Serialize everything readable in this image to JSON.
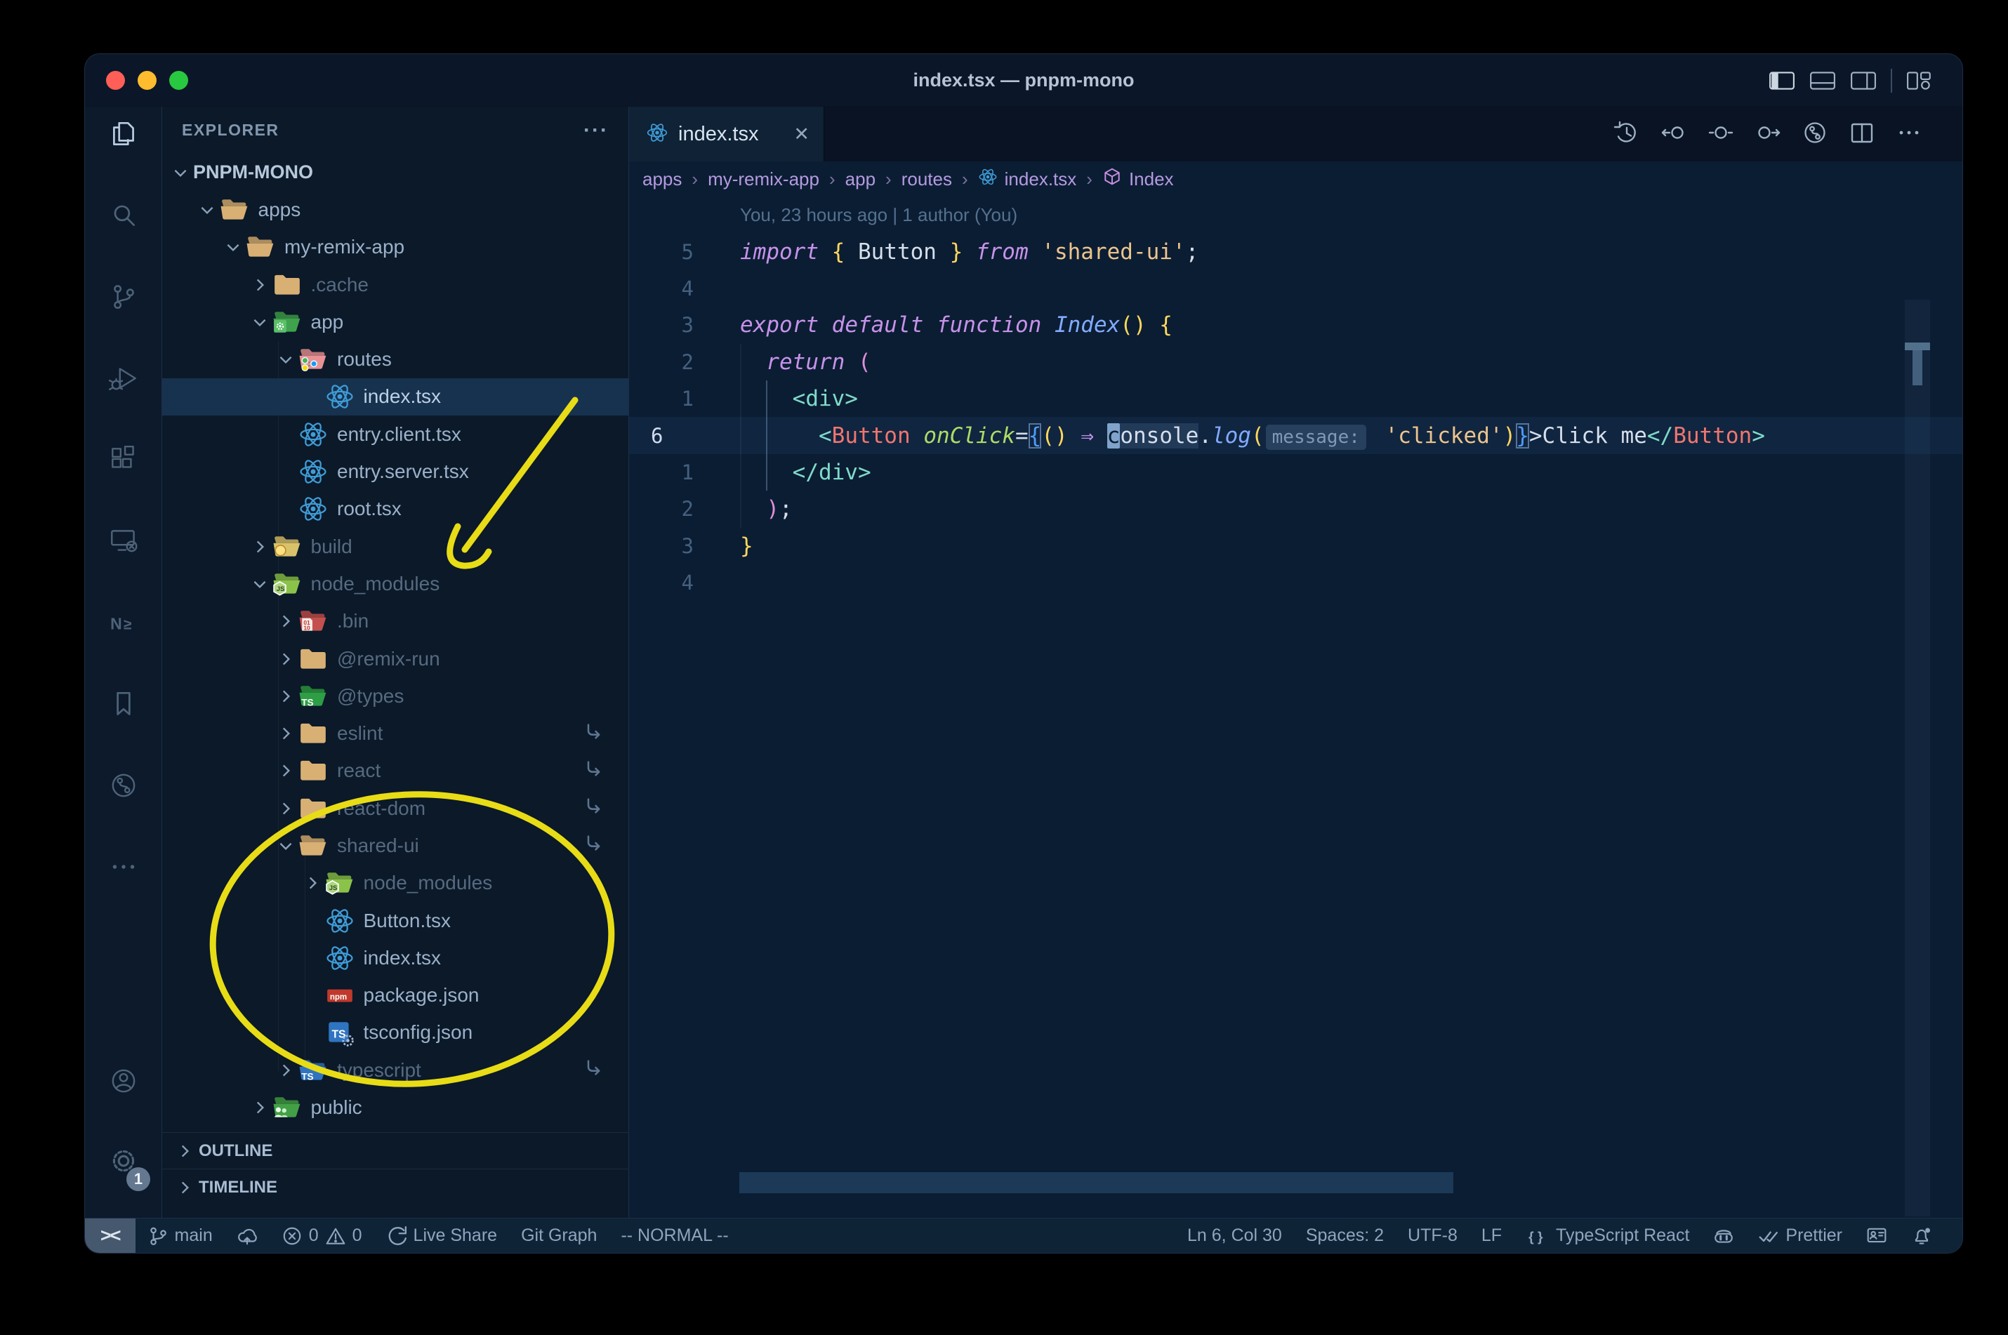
{
  "window": {
    "title": "index.tsx — pnpm-mono"
  },
  "titlebar": {
    "traffic_lights": [
      "close",
      "minimize",
      "zoom"
    ],
    "layout_buttons": [
      "layout-sidebar-left",
      "layout-panel",
      "layout-sidebar-right",
      "layout-customize"
    ]
  },
  "activity_bar": {
    "top": [
      {
        "name": "explorer",
        "active": true
      },
      {
        "name": "search"
      },
      {
        "name": "source-control"
      },
      {
        "name": "run-and-debug"
      },
      {
        "name": "extensions"
      },
      {
        "name": "remote-explorer"
      },
      {
        "name": "nx-console"
      },
      {
        "name": "bookmarks"
      },
      {
        "name": "gitlens"
      },
      {
        "name": "more"
      }
    ],
    "bottom": [
      {
        "name": "accounts"
      },
      {
        "name": "manage",
        "badge": "1"
      }
    ]
  },
  "sidebar": {
    "title": "EXPLORER",
    "actions_label": "···",
    "tree": [
      {
        "label": "PNPM-MONO",
        "depth": 0,
        "chevron": "open",
        "section": true
      },
      {
        "label": "apps",
        "depth": 1,
        "icon": "folder-open",
        "chevron": "open"
      },
      {
        "label": "my-remix-app",
        "depth": 2,
        "icon": "folder-open",
        "chevron": "open"
      },
      {
        "label": ".cache",
        "depth": 3,
        "icon": "folder",
        "chevron": "closed",
        "dim": true
      },
      {
        "label": "app",
        "depth": 3,
        "icon": "folder-app",
        "chevron": "open"
      },
      {
        "label": "routes",
        "depth": 4,
        "icon": "folder-routes",
        "chevron": "open"
      },
      {
        "label": "index.tsx",
        "depth": 5,
        "icon": "react",
        "selected": true
      },
      {
        "label": "entry.client.tsx",
        "depth": 4,
        "icon": "react"
      },
      {
        "label": "entry.server.tsx",
        "depth": 4,
        "icon": "react"
      },
      {
        "label": "root.tsx",
        "depth": 4,
        "icon": "react"
      },
      {
        "label": "build",
        "depth": 3,
        "icon": "folder-build",
        "chevron": "closed",
        "dim": true
      },
      {
        "label": "node_modules",
        "depth": 3,
        "icon": "folder-node",
        "chevron": "open",
        "dim": true
      },
      {
        "label": ".bin",
        "depth": 4,
        "icon": "folder-bin",
        "chevron": "closed",
        "dim": true
      },
      {
        "label": "@remix-run",
        "depth": 4,
        "icon": "folder",
        "chevron": "closed",
        "dim": true
      },
      {
        "label": "@types",
        "depth": 4,
        "icon": "folder-types",
        "chevron": "closed",
        "dim": true
      },
      {
        "label": "eslint",
        "depth": 4,
        "icon": "folder",
        "chevron": "closed",
        "dim": true,
        "symlink": true
      },
      {
        "label": "react",
        "depth": 4,
        "icon": "folder",
        "chevron": "closed",
        "dim": true,
        "symlink": true
      },
      {
        "label": "react-dom",
        "depth": 4,
        "icon": "folder",
        "chevron": "closed",
        "dim": true,
        "symlink": true
      },
      {
        "label": "shared-ui",
        "depth": 4,
        "icon": "folder-open",
        "chevron": "open",
        "dim": true,
        "symlink": true
      },
      {
        "label": "node_modules",
        "depth": 5,
        "icon": "folder-node",
        "chevron": "closed",
        "dim": true
      },
      {
        "label": "Button.tsx",
        "depth": 5,
        "icon": "react"
      },
      {
        "label": "index.tsx",
        "depth": 5,
        "icon": "react"
      },
      {
        "label": "package.json",
        "depth": 5,
        "icon": "npm"
      },
      {
        "label": "tsconfig.json",
        "depth": 5,
        "icon": "tsconfig"
      },
      {
        "label": "typescript",
        "depth": 4,
        "icon": "folder-ts",
        "chevron": "closed",
        "dim": true,
        "symlink": true
      },
      {
        "label": "public",
        "depth": 3,
        "icon": "folder-public",
        "chevron": "closed"
      }
    ],
    "sections": [
      {
        "label": "OUTLINE"
      },
      {
        "label": "TIMELINE"
      }
    ]
  },
  "editor": {
    "tab": {
      "label": "index.tsx",
      "icon": "react",
      "close_glyph": "✕"
    },
    "actions": [
      "timeline-history",
      "previous-change",
      "open-changes",
      "next-change",
      "commit-graph",
      "split-editor",
      "more-actions"
    ],
    "breadcrumb_separator": "›",
    "breadcrumbs": [
      {
        "label": "apps"
      },
      {
        "label": "my-remix-app"
      },
      {
        "label": "app"
      },
      {
        "label": "routes"
      },
      {
        "label": "index.tsx",
        "icon": "react"
      },
      {
        "label": "Index",
        "icon": "symbol-module"
      }
    ],
    "blame": "You, 23 hours ago | 1 author (You)",
    "lines": [
      {
        "gutter": "5",
        "tokens": [
          [
            "kw",
            "import"
          ],
          [
            "txt",
            " "
          ],
          [
            "b1",
            "{"
          ],
          [
            "txt",
            " Button "
          ],
          [
            "b1",
            "}"
          ],
          [
            "kw",
            " from"
          ],
          [
            "txt",
            " "
          ],
          [
            "str",
            "'shared-ui'"
          ],
          [
            "txt",
            ";"
          ]
        ]
      },
      {
        "gutter": "4",
        "tokens": []
      },
      {
        "gutter": "3",
        "tokens": [
          [
            "kw",
            "export"
          ],
          [
            "txt",
            " "
          ],
          [
            "kw",
            "default"
          ],
          [
            "txt",
            " "
          ],
          [
            "kw",
            "function"
          ],
          [
            "txt",
            " "
          ],
          [
            "fn",
            "Index"
          ],
          [
            "b1",
            "()"
          ],
          [
            "txt",
            " "
          ],
          [
            "b1",
            "{"
          ]
        ]
      },
      {
        "gutter": "2",
        "tokens": [
          [
            "txt",
            "  "
          ],
          [
            "kw",
            "return"
          ],
          [
            "txt",
            " "
          ],
          [
            "b2",
            "("
          ]
        ]
      },
      {
        "gutter": "1",
        "tokens": [
          [
            "txt",
            "    "
          ],
          [
            "tag",
            "<div>"
          ]
        ]
      },
      {
        "gutter": "6",
        "current": true,
        "tokens": [
          [
            "txt",
            "      "
          ],
          [
            "tag",
            "<"
          ],
          [
            "comp",
            "Button"
          ],
          [
            "txt",
            " "
          ],
          [
            "attr",
            "onClick"
          ],
          [
            "txt",
            "="
          ],
          [
            "b3m",
            "{"
          ],
          [
            "b1",
            "()"
          ],
          [
            "txt",
            " "
          ],
          [
            "arrow",
            "⇒"
          ],
          [
            "txt",
            " "
          ],
          [
            "cur",
            "c"
          ],
          [
            "whl",
            "onsole"
          ],
          [
            "txt",
            "."
          ],
          [
            "fn",
            "log"
          ],
          [
            "b1",
            "("
          ],
          [
            "inlay",
            "message:"
          ],
          [
            "txt",
            " "
          ],
          [
            "str",
            "'clicked'"
          ],
          [
            "b1",
            ")"
          ],
          [
            "b3m",
            "}"
          ],
          [
            "txt",
            ">Click me"
          ],
          [
            "tag",
            "</"
          ],
          [
            "comp",
            "Button"
          ],
          [
            "tag",
            ">"
          ]
        ]
      },
      {
        "gutter": "1",
        "tokens": [
          [
            "txt",
            "    "
          ],
          [
            "tag",
            "</div>"
          ]
        ]
      },
      {
        "gutter": "2",
        "tokens": [
          [
            "txt",
            "  "
          ],
          [
            "b2",
            ")"
          ],
          [
            "txt",
            ";"
          ]
        ]
      },
      {
        "gutter": "3",
        "tokens": [
          [
            "b1",
            "}"
          ]
        ]
      },
      {
        "gutter": "4",
        "tokens": []
      }
    ]
  },
  "status_bar": {
    "left": [
      {
        "name": "remote-indicator",
        "chip": true,
        "segs": [
          [
            "text",
            "><"
          ]
        ]
      },
      {
        "name": "git-branch",
        "segs": [
          [
            "icon",
            "git-branch"
          ],
          [
            "text",
            "main"
          ]
        ]
      },
      {
        "name": "sync",
        "segs": [
          [
            "icon",
            "cloud-upload"
          ]
        ]
      },
      {
        "name": "problems",
        "segs": [
          [
            "icon",
            "error"
          ],
          [
            "text",
            "0"
          ],
          [
            "icon",
            "warning"
          ],
          [
            "text",
            "0"
          ]
        ]
      },
      {
        "name": "live-share",
        "segs": [
          [
            "icon",
            "live-share"
          ],
          [
            "text",
            "Live Share"
          ]
        ]
      },
      {
        "name": "git-graph",
        "segs": [
          [
            "text",
            "Git Graph"
          ]
        ]
      },
      {
        "name": "vim-mode",
        "segs": [
          [
            "text",
            "-- NORMAL --"
          ]
        ]
      }
    ],
    "right": [
      {
        "name": "cursor-position",
        "segs": [
          [
            "text",
            "Ln 6, Col 30"
          ]
        ]
      },
      {
        "name": "indentation",
        "segs": [
          [
            "text",
            "Spaces: 2"
          ]
        ]
      },
      {
        "name": "encoding",
        "segs": [
          [
            "text",
            "UTF-8"
          ]
        ]
      },
      {
        "name": "eol",
        "segs": [
          [
            "text",
            "LF"
          ]
        ]
      },
      {
        "name": "language-mode",
        "segs": [
          [
            "icon",
            "brackets"
          ],
          [
            "text",
            "TypeScript React"
          ]
        ]
      },
      {
        "name": "copilot",
        "segs": [
          [
            "icon",
            "copilot"
          ]
        ]
      },
      {
        "name": "prettier",
        "segs": [
          [
            "icon",
            "double-check"
          ],
          [
            "text",
            "Prettier"
          ]
        ]
      },
      {
        "name": "feedback",
        "segs": [
          [
            "icon",
            "feedback"
          ]
        ]
      },
      {
        "name": "notifications",
        "segs": [
          [
            "icon",
            "bell-dot"
          ]
        ]
      }
    ]
  },
  "colors": {
    "bg_page": "#000000",
    "bg_title": "#0b1728",
    "bg_tabbar": "#091323",
    "bg_tabActive": "#0f2236",
    "bg_editor": "#0b1d33",
    "bg_sidebar": "#0b1929",
    "bg_activity": "#0c1a2c",
    "bg_status": "#0f2337",
    "chipBg": "#46586e",
    "border": "#1c2e47",
    "traffic_red": "#ff5f57",
    "traffic_yellow": "#febc2e",
    "traffic_green": "#28c840",
    "iconDim": "#4e6378",
    "iconActive": "#b9cbdf",
    "badgeBg": "#64788f",
    "explorerText": "#8297ad",
    "treeText": "#9bb1c9",
    "dimText": "#566a80",
    "sectionText": "#b8c8db",
    "selRow": "#17324f",
    "curLine": "#102540",
    "statusText": "#8fa5bd",
    "crumb": "#b49ae0",
    "crumbSep": "#7e729f",
    "kw": "#c792ea",
    "fn": "#82aaff",
    "txt": "#d6deeb",
    "tag": "#7fdbca",
    "comp": "#f0766f",
    "attr": "#addb67",
    "str": "#ecc48d",
    "b1": "#ffd75e",
    "b2": "#df8fd8",
    "b3": "#4d9df8",
    "arrow": "#c792ea",
    "lnum": "#44607e",
    "lnumA": "#cfdcee",
    "blame": "#54718e",
    "cursorBg": "#7fa3cb",
    "inlayBg": "#26405e",
    "inlayText": "#8299b5",
    "bracketMatch": "#56749a",
    "annotation_yellow": "#e8dc16",
    "reactBlue": "#3f9cd6",
    "folderTan": "#d8b074",
    "folderGreen": "#3fa34d",
    "folderPink": "#e89296",
    "folderNode": "#8bc34a",
    "folderRed": "#c3504f",
    "tsBlue": "#2f74c0",
    "npmRed": "#c0392b",
    "publicGreen": "#43a047"
  }
}
